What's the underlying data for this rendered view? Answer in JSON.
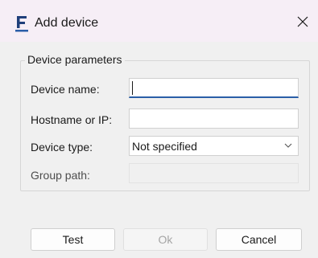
{
  "window": {
    "title": "Add device",
    "app_icon_letter": "F",
    "accent_color": "#2a5ea8"
  },
  "group": {
    "legend": "Device parameters"
  },
  "fields": {
    "device_name": {
      "label": "Device name:",
      "value": ""
    },
    "hostname": {
      "label": "Hostname or IP:",
      "value": ""
    },
    "device_type": {
      "label": "Device type:",
      "selected": "Not specified"
    },
    "group_path": {
      "label": "Group path:",
      "value": ""
    }
  },
  "buttons": {
    "test": "Test",
    "ok": "Ok",
    "cancel": "Cancel"
  },
  "icons": {
    "close": "close-icon",
    "dropdown": "chevron-down-icon",
    "app": "app-logo-icon"
  }
}
